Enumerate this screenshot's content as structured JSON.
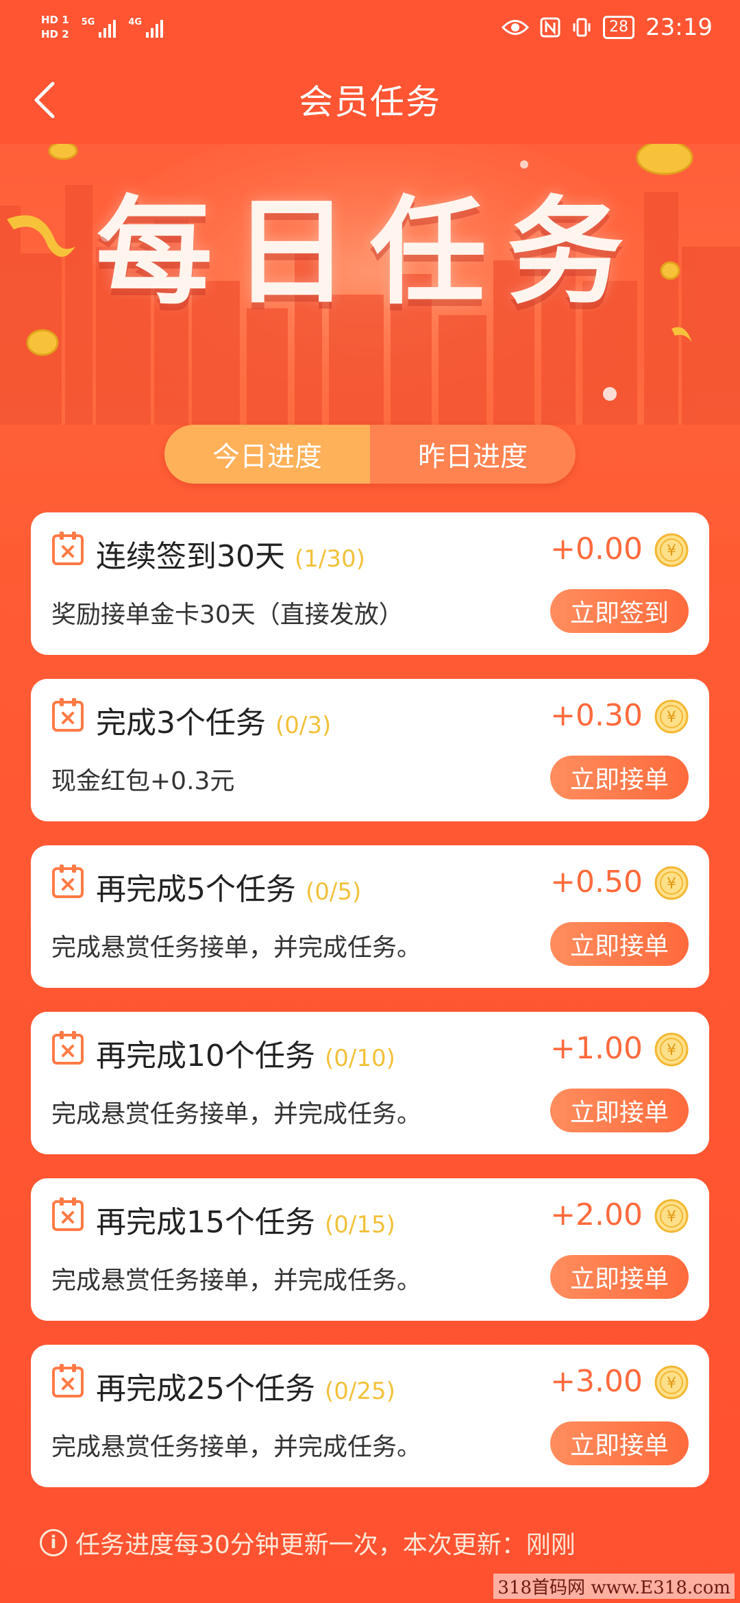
{
  "status_bar": {
    "hd1": "HD 1",
    "hd2": "HD 2",
    "net1": "5G",
    "net2": "4G",
    "battery": "28",
    "time": "23:19"
  },
  "header": {
    "title": "会员任务"
  },
  "banner": {
    "title": "每日任务"
  },
  "tabs": [
    {
      "label": "今日进度",
      "active": true
    },
    {
      "label": "昨日进度",
      "active": false
    }
  ],
  "tasks": [
    {
      "title": "连续签到30天",
      "progress": "(1/30)",
      "reward": "+0.00",
      "desc": "奖励接单金卡30天（直接发放）",
      "button": "立即签到"
    },
    {
      "title": "完成3个任务",
      "progress": "(0/3)",
      "reward": "+0.30",
      "desc": "现金红包+0.3元",
      "button": "立即接单"
    },
    {
      "title": "再完成5个任务",
      "progress": "(0/5)",
      "reward": "+0.50",
      "desc": "完成悬赏任务接单，并完成任务。",
      "button": "立即接单"
    },
    {
      "title": "再完成10个任务",
      "progress": "(0/10)",
      "reward": "+1.00",
      "desc": "完成悬赏任务接单，并完成任务。",
      "button": "立即接单"
    },
    {
      "title": "再完成15个任务",
      "progress": "(0/15)",
      "reward": "+2.00",
      "desc": "完成悬赏任务接单，并完成任务。",
      "button": "立即接单"
    },
    {
      "title": "再完成25个任务",
      "progress": "(0/25)",
      "reward": "+3.00",
      "desc": "完成悬赏任务接单，并完成任务。",
      "button": "立即接单"
    }
  ],
  "footer": {
    "info_icon": "i",
    "note": "任务进度每30分钟更新一次，本次更新：刚刚"
  },
  "watermark": "318首码网 www.E318.com",
  "colors": {
    "accent": "#ff5533",
    "reward": "#ff6a3c",
    "progress": "#f2c13b"
  }
}
